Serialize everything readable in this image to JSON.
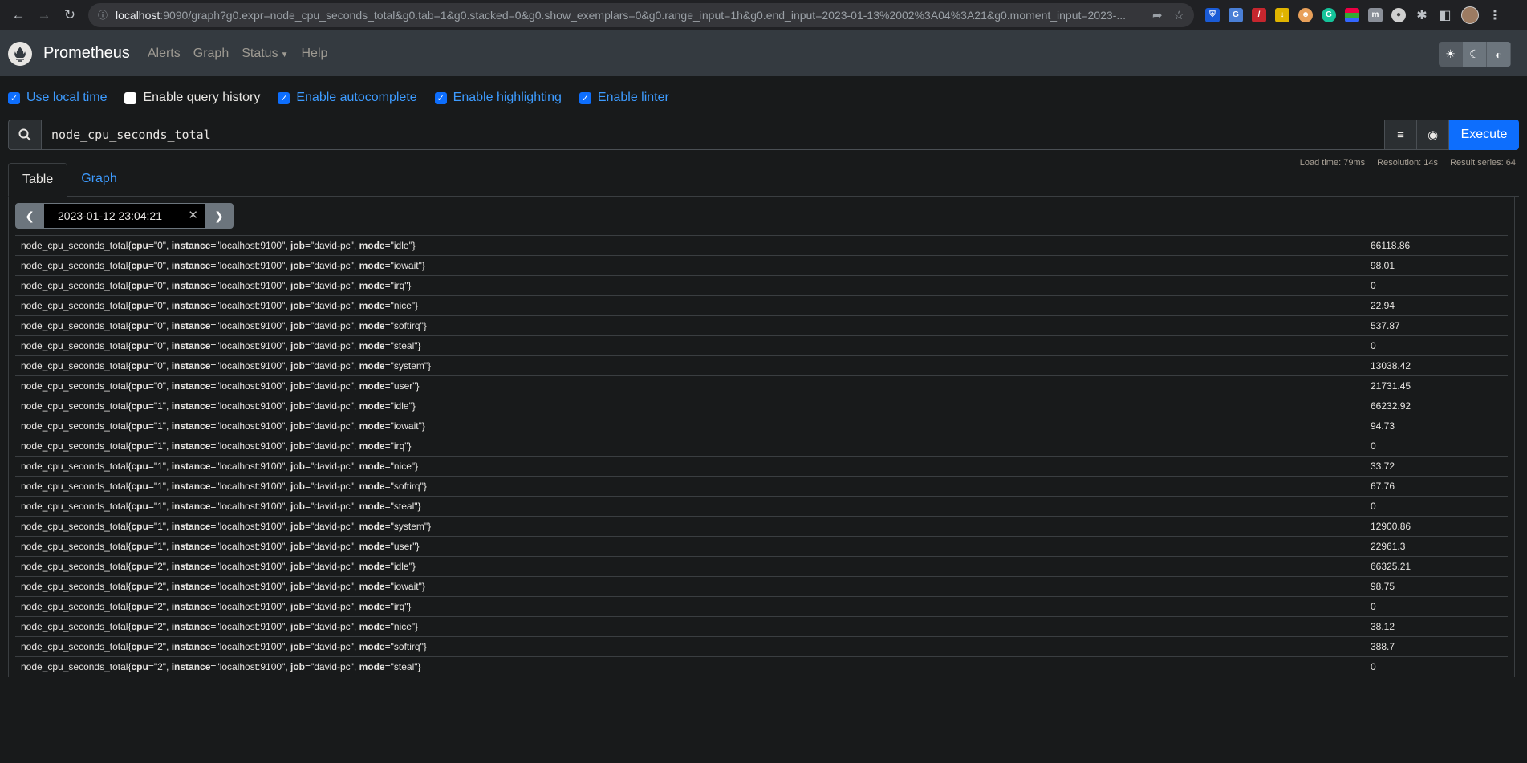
{
  "browser": {
    "url_host": "localhost",
    "url_rest": ":9090/graph?g0.expr=node_cpu_seconds_total&g0.tab=1&g0.stacked=0&g0.show_exemplars=0&g0.range_input=1h&g0.end_input=2023-01-13%2002%3A04%3A21&g0.moment_input=2023-..."
  },
  "navbar": {
    "brand": "Prometheus",
    "links": [
      "Alerts",
      "Graph",
      "Status",
      "Help"
    ]
  },
  "options": [
    {
      "label": "Use local time",
      "checked": true
    },
    {
      "label": "Enable query history",
      "checked": false
    },
    {
      "label": "Enable autocomplete",
      "checked": true
    },
    {
      "label": "Enable highlighting",
      "checked": true
    },
    {
      "label": "Enable linter",
      "checked": true
    }
  ],
  "query": {
    "expr": "node_cpu_seconds_total",
    "execute_label": "Execute"
  },
  "tabs": [
    "Table",
    "Graph"
  ],
  "stats": {
    "load_time": "Load time: 79ms",
    "resolution": "Resolution: 14s",
    "result_series": "Result series: 64"
  },
  "time_input": "2023-01-12 23:04:21",
  "metric_name": "node_cpu_seconds_total",
  "instance": "localhost:9100",
  "job": "david-pc",
  "rows": [
    {
      "cpu": "0",
      "mode": "idle",
      "value": "66118.86"
    },
    {
      "cpu": "0",
      "mode": "iowait",
      "value": "98.01"
    },
    {
      "cpu": "0",
      "mode": "irq",
      "value": "0"
    },
    {
      "cpu": "0",
      "mode": "nice",
      "value": "22.94"
    },
    {
      "cpu": "0",
      "mode": "softirq",
      "value": "537.87"
    },
    {
      "cpu": "0",
      "mode": "steal",
      "value": "0"
    },
    {
      "cpu": "0",
      "mode": "system",
      "value": "13038.42"
    },
    {
      "cpu": "0",
      "mode": "user",
      "value": "21731.45"
    },
    {
      "cpu": "1",
      "mode": "idle",
      "value": "66232.92"
    },
    {
      "cpu": "1",
      "mode": "iowait",
      "value": "94.73"
    },
    {
      "cpu": "1",
      "mode": "irq",
      "value": "0"
    },
    {
      "cpu": "1",
      "mode": "nice",
      "value": "33.72"
    },
    {
      "cpu": "1",
      "mode": "softirq",
      "value": "67.76"
    },
    {
      "cpu": "1",
      "mode": "steal",
      "value": "0"
    },
    {
      "cpu": "1",
      "mode": "system",
      "value": "12900.86"
    },
    {
      "cpu": "1",
      "mode": "user",
      "value": "22961.3"
    },
    {
      "cpu": "2",
      "mode": "idle",
      "value": "66325.21"
    },
    {
      "cpu": "2",
      "mode": "iowait",
      "value": "98.75"
    },
    {
      "cpu": "2",
      "mode": "irq",
      "value": "0"
    },
    {
      "cpu": "2",
      "mode": "nice",
      "value": "38.12"
    },
    {
      "cpu": "2",
      "mode": "softirq",
      "value": "388.7"
    },
    {
      "cpu": "2",
      "mode": "steal",
      "value": "0"
    }
  ],
  "colors": {
    "accent": "#0d6efd",
    "link": "#3d9bff",
    "navbar": "#343a40",
    "background": "#181a1b"
  }
}
